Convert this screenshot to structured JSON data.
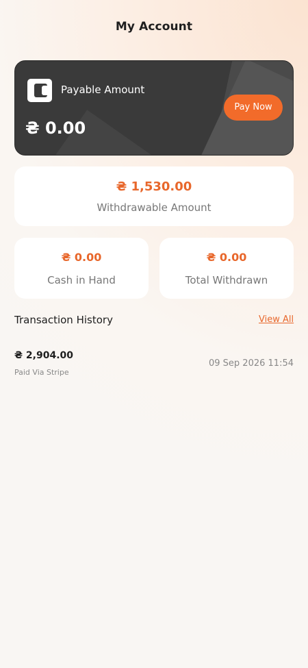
{
  "header": {
    "title": "My Account"
  },
  "payable": {
    "label": "Payable Amount",
    "amount": "₴ 0.00",
    "pay_button": "Pay Now",
    "icon": "wallet-icon"
  },
  "withdrawable": {
    "amount": "₴ 1,530.00",
    "label": "Withdrawable Amount"
  },
  "cash_in_hand": {
    "amount": "₴ 0.00",
    "label": "Cash in Hand"
  },
  "total_withdrawn": {
    "amount": "₴ 0.00",
    "label": "Total Withdrawn"
  },
  "transactions": {
    "title": "Transaction History",
    "view_all": "View All",
    "items": [
      {
        "amount": "₴ 2,904.00",
        "method": "Paid Via Stripe",
        "date": "09 Sep 2026 11:54"
      }
    ]
  },
  "colors": {
    "accent": "#f26b2a",
    "card_dark": "#3a3a3a",
    "accent_text": "#e8672b"
  }
}
